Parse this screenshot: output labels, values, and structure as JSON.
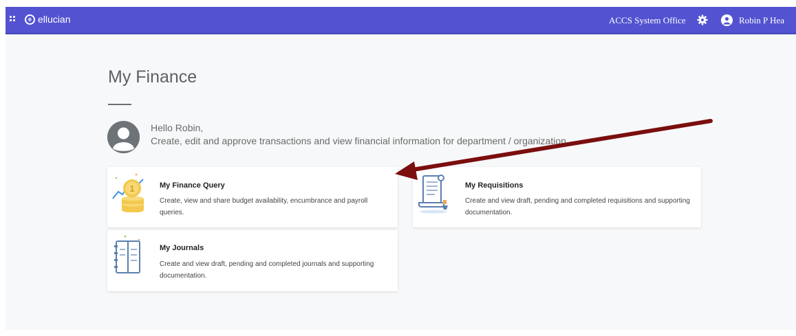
{
  "header": {
    "brand": "ellucian",
    "office": "ACCS System Office",
    "user_name": "Robin P Hea"
  },
  "page": {
    "title": "My Finance",
    "greeting": "Hello Robin,",
    "subtitle": "Create, edit and approve transactions and view financial information for department / organization."
  },
  "cards": [
    {
      "title": "My Finance Query",
      "description": "Create, view and share budget availability, encumbrance and payroll queries.",
      "icon": "coins-chart-icon"
    },
    {
      "title": "My Requisitions",
      "description": "Create and view draft, pending and completed requisitions and supporting documentation.",
      "icon": "requisition-scroll-icon"
    },
    {
      "title": "My Journals",
      "description": "Create and view draft, pending and completed journals and supporting documentation.",
      "icon": "journal-book-icon"
    }
  ],
  "colors": {
    "header_bg": "#5353d1",
    "arrow": "#7b0e0e"
  }
}
